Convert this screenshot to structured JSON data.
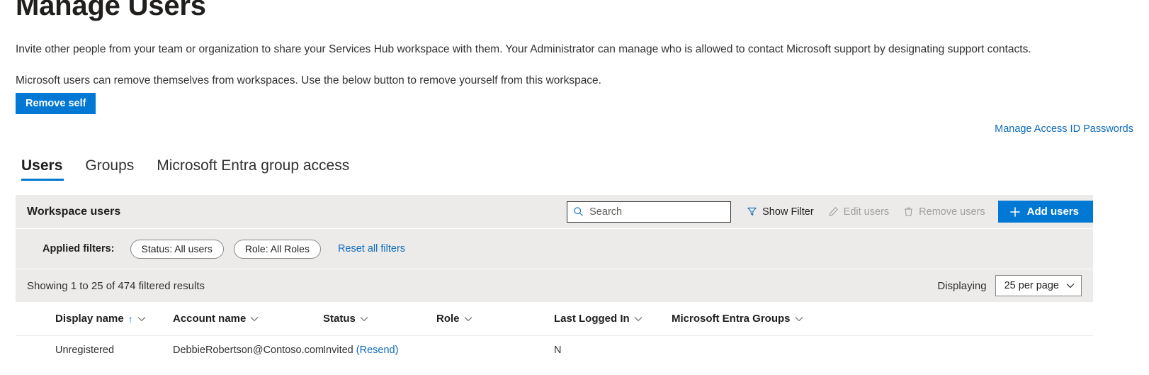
{
  "page": {
    "title": "Manage Users",
    "intro_paragraph_1": "Invite other people from your team or organization to share your Services Hub workspace with them. Your Administrator can manage who is allowed to contact Microsoft support by designating support contacts.",
    "intro_paragraph_2": "Microsoft users can remove themselves from workspaces. Use the below button to remove yourself from this workspace.",
    "remove_self_label": "Remove self",
    "manage_access_link": "Manage Access ID Passwords"
  },
  "tabs": [
    {
      "label": "Users",
      "active": true
    },
    {
      "label": "Groups",
      "active": false
    },
    {
      "label": "Microsoft Entra group access",
      "active": false
    }
  ],
  "toolbar": {
    "title": "Workspace users",
    "search_placeholder": "Search",
    "search_value": "",
    "show_filter_label": "Show Filter",
    "edit_users_label": "Edit users",
    "remove_users_label": "Remove users",
    "add_users_label": "Add users"
  },
  "filters": {
    "label": "Applied filters:",
    "pills": [
      {
        "label": "Status: All users"
      },
      {
        "label": "Role: All Roles"
      }
    ],
    "reset_label": "Reset all filters"
  },
  "results": {
    "showing_text": "Showing 1 to 25 of 474 filtered results",
    "displaying_label": "Displaying",
    "page_size_value": "25 per page"
  },
  "table": {
    "columns": [
      {
        "label": "Display name",
        "sorted": true
      },
      {
        "label": "Account name",
        "sorted": false
      },
      {
        "label": "Status",
        "sorted": false
      },
      {
        "label": "Role",
        "sorted": false
      },
      {
        "label": "Last Logged In",
        "sorted": false
      },
      {
        "label": "Microsoft Entra Groups",
        "sorted": false
      }
    ],
    "rows": [
      {
        "display_name": "Unregistered",
        "account_name": "DebbieRobertson@Contoso.com",
        "status": "Invited",
        "status_action": "(Resend)",
        "role": "",
        "last_logged_in": "N",
        "entra_groups": ""
      }
    ]
  },
  "colors": {
    "accent": "#0078d4",
    "link": "#0f6cbd",
    "panel_gray": "#edebe9",
    "text": "#323130",
    "disabled": "#a19f9d"
  }
}
